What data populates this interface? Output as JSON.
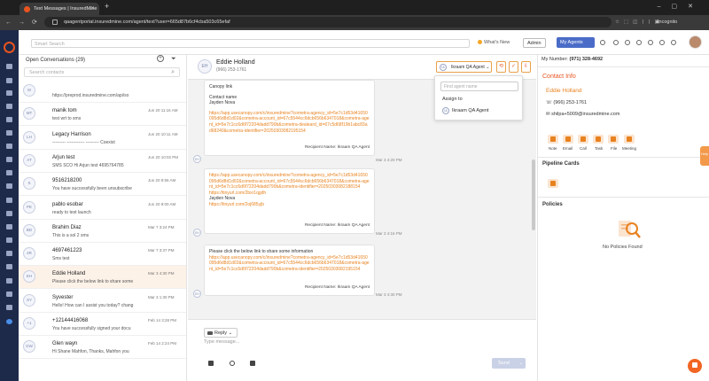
{
  "browser": {
    "tab_title": "Text Messages | InsuredMine",
    "url": "qaagentportal.insuredmine.com/agent/text?user=665d87b6cf4cba503c65efaf",
    "incognito_label": "Incognito"
  },
  "header": {
    "search_placeholder": "Smart Search",
    "whats_new": "What's New",
    "role": "Admin",
    "my_agents": "My Agents"
  },
  "conversations": {
    "title": "Open Conversations (29)",
    "search_placeholder": "Search contacts",
    "items": [
      {
        "initials": "M",
        "name": "",
        "preview": "https://preprod.insuredmine.com/api/so",
        "date": ""
      },
      {
        "initials": "MT",
        "name": "manik tom",
        "preview": "test wrt to sms",
        "date": "Jun 20 11:16 AM"
      },
      {
        "initials": "LH",
        "name": "Legacy Harrison",
        "preview": "--------- ------------ --------- Coexist",
        "date": "Jun 20 10:11 AM"
      },
      {
        "initials": "AT",
        "name": "Arjun test",
        "preview": "SMS SCO Hi Arjun test 4695764785",
        "date": "Jun 20 10:02 PM"
      },
      {
        "initials": "S",
        "name": "9516218200",
        "preview": "You have successfully been unsubscribe",
        "date": "Jun 20 9:56 AM"
      },
      {
        "initials": "PE",
        "name": "pablo esobar",
        "preview": "ready to test launch",
        "date": "Jun 20 9:00 AM"
      },
      {
        "initials": "BD",
        "name": "Brahim Diaz",
        "preview": "This is a sol 2 sms",
        "date": "Mar 7 3:24 PM"
      },
      {
        "initials": "4R",
        "name": "4697461223",
        "preview": "Sms test",
        "date": "Mar 7 3:37 PM"
      },
      {
        "initials": "EH",
        "name": "Eddie Holland",
        "preview": "Please click the below link to share some",
        "date": "Mar 3 4:30 PM"
      },
      {
        "initials": "SY",
        "name": "Syvester",
        "preview": "Hello! How can I assist you today? chang",
        "date": "Mar 3 1:30 PM"
      },
      {
        "initials": "+1",
        "name": "+12144416068",
        "preview": "You have successfully signed your docu",
        "date": "Feb 14 3:28 PM"
      },
      {
        "initials": "GW",
        "name": "Glen wayn",
        "preview": "Hi Shane Mahfon, Thanks, Mahfon you",
        "date": "Feb 14 2:24 PM"
      }
    ]
  },
  "chat": {
    "contact_initials": "EH",
    "contact_name": "Eddie Holland",
    "contact_phone": "(966) 253-1761",
    "assigned_agent_initials": "IA",
    "assigned_agent": "Ikraam QA Agent",
    "agent_search_placeholder": "Find agent name",
    "assign_label": "Assign to",
    "agent_option": "Ikraam QA Agent",
    "reply_label": "Reply",
    "message_placeholder": "Type message...",
    "send_label": "Send",
    "sender_initials": "EH",
    "messages": [
      {
        "pre": "Canopy link",
        "name_label": "Contact name",
        "name_value": "Jayden Nova",
        "link": "https://app.usecanopy.com/c/insuredmine?cometra-agency_id=5e7c1d53d41650095d6d8d1d02&cometra-account_id=67c5544cc6dcb656b6347018&cometra-agent_id=5e7c1cc6d6f72204dadd790b&cometra-dealeard_id=67c5d68f19b1abc83ad68240&cometra-identifier=20250303082195154",
        "recipient": "Recipient Name: Ikraam QA Agent",
        "time": "Mar 3 4:20 PM"
      },
      {
        "link": "https://app.usecanopy.com/c/insuredmine?cometra-agency_id=5e7c1d53d41650095d6d8d1d02&cometra-account_id=67c5544cc6dcb656b6347018&cometra-agent_id=5e7c1cc6d6f72204dadd790b&cometra-identifier=20250303082188154",
        "short_link": "https://tinyurl.com/2bxr1qgdh",
        "name_value": "Jayden Nova",
        "short_link2": "https://tinyurl.com/2oj685yjb",
        "recipient": "Recipient Name: Ikraam QA Agent",
        "time": "Mar 3 4:16 PM"
      },
      {
        "pre": "Please click the below link to share some information",
        "link": "https://app.usecanopy.com/c/insuredmine?cometra-agency_id=5e7c1d53d41650095d6d8d1d02&cometra-account_id=67c5544cc6dcb656b6347018&cometra-agent_id=5e7c1cc6d6f72204dadd790b&cometra-identifier=20250303082195154",
        "recipient": "Recipient Name: Ikraam QA Agent",
        "time": "Mar 3 4:30 PM"
      }
    ]
  },
  "contact": {
    "my_number_label": "My Number:",
    "my_number": "(971) 328-4692",
    "info_title": "Contact Info",
    "name": "Eddie Holland",
    "phone": "(966) 253-1761",
    "email": "shilpa+5009@insuredmine.com",
    "actions": [
      "Note",
      "Email",
      "Call",
      "Task",
      "File",
      "Meeting"
    ],
    "pipeline_title": "Pipeline Cards",
    "policies_title": "Policies",
    "no_policies": "No Policies Found",
    "help_label": "Help"
  },
  "colors": {
    "accent": "#e8541f",
    "link": "#e8821f",
    "sidebar": "#1e2a4a",
    "primary_button": "#4a6cc8"
  }
}
